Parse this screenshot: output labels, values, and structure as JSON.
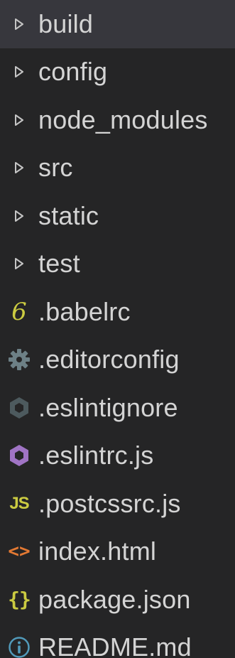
{
  "explorer": {
    "items": [
      {
        "label": "build",
        "kind": "folder",
        "icon": "chevron-right-icon",
        "selected": true
      },
      {
        "label": "config",
        "kind": "folder",
        "icon": "chevron-right-icon"
      },
      {
        "label": "node_modules",
        "kind": "folder",
        "icon": "chevron-right-icon"
      },
      {
        "label": "src",
        "kind": "folder",
        "icon": "chevron-right-icon"
      },
      {
        "label": "static",
        "kind": "folder",
        "icon": "chevron-right-icon"
      },
      {
        "label": "test",
        "kind": "folder",
        "icon": "chevron-right-icon"
      },
      {
        "label": ".babelrc",
        "kind": "file",
        "icon": "babel-icon",
        "color": "#cbcb41"
      },
      {
        "label": ".editorconfig",
        "kind": "file",
        "icon": "gear-icon",
        "color": "#6d8086"
      },
      {
        "label": ".eslintignore",
        "kind": "file",
        "icon": "eslint-ignore-icon",
        "color": "#4d5a5e"
      },
      {
        "label": ".eslintrc.js",
        "kind": "file",
        "icon": "eslint-icon",
        "color": "#a074c4"
      },
      {
        "label": ".postcssrc.js",
        "kind": "file",
        "icon": "javascript-icon",
        "color": "#cbcb41"
      },
      {
        "label": "index.html",
        "kind": "file",
        "icon": "html-icon",
        "color": "#e37933"
      },
      {
        "label": "package.json",
        "kind": "file",
        "icon": "json-icon",
        "color": "#cbcb41"
      },
      {
        "label": "README.md",
        "kind": "file",
        "icon": "info-icon",
        "color": "#519aba"
      }
    ]
  }
}
